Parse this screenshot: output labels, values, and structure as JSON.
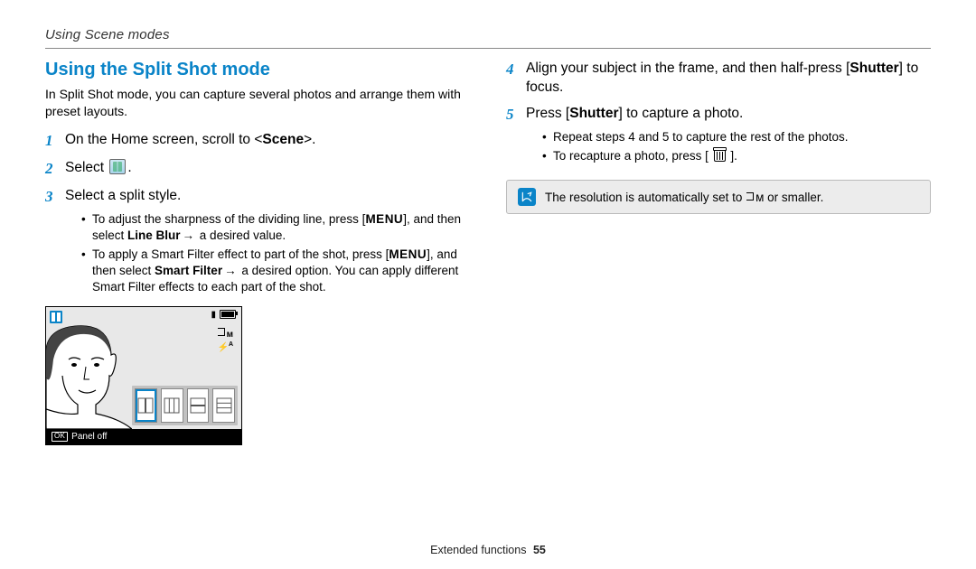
{
  "header": "Using Scene modes",
  "title": "Using the Split Shot mode",
  "intro": "In Split Shot mode, you can capture several photos and arrange them with preset layouts.",
  "steps_left": {
    "s1": {
      "text": "On the Home screen, scroll to <",
      "bold": "Scene",
      "after": ">."
    },
    "s2": {
      "pre": "Select ",
      "post": "."
    },
    "s3": {
      "text": "Select a split style."
    },
    "sub3": {
      "a1": "To adjust the sharpness of the dividing line, press [",
      "a1b": "MENU",
      "a1c": "], and then select ",
      "a1d": "Line Blur",
      "a1e": " a desired value.",
      "b1": "To apply a Smart Filter effect to part of the shot, press [",
      "b1b": "MENU",
      "b1c": "], and then select ",
      "b1d": "Smart Filter",
      "b1e": " a desired option. You can apply different Smart Filter effects to each part of the shot."
    }
  },
  "steps_right": {
    "s4a": "Align your subject in the frame, and then half-press [",
    "s4b": "Shutter",
    "s4c": "] to focus.",
    "s5a": "Press [",
    "s5b": "Shutter",
    "s5c": "] to capture a photo.",
    "sub5": {
      "a": "Repeat steps 4 and 5 to capture the rest of the photos.",
      "b1": "To recapture a photo, press [ ",
      "b2": " ]."
    }
  },
  "note": {
    "pre": "The resolution is automatically set to ",
    "suffix": " or smaller."
  },
  "camera": {
    "panel_off": "Panel off",
    "res": "ᴍ",
    "flash": "A"
  },
  "footer": {
    "section": "Extended functions",
    "page": "55"
  }
}
